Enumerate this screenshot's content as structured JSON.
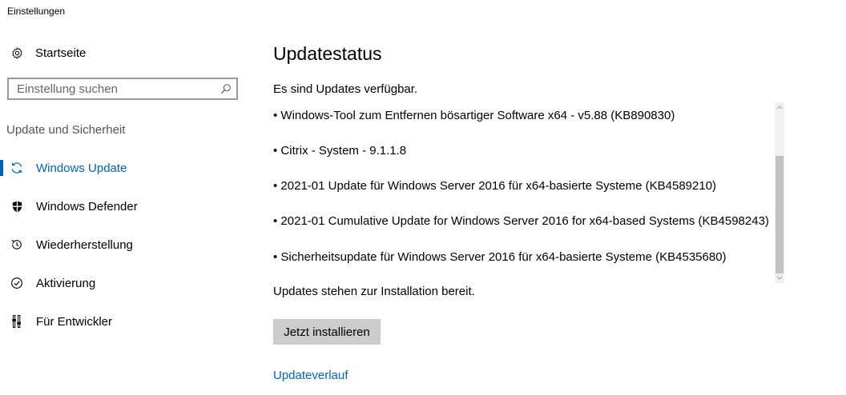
{
  "window": {
    "title": "Einstellungen"
  },
  "sidebar": {
    "home_label": "Startseite",
    "search": {
      "placeholder": "Einstellung suchen",
      "value": ""
    },
    "section_title": "Update und Sicherheit",
    "items": [
      {
        "label": "Windows Update",
        "icon": "refresh-icon",
        "active": true
      },
      {
        "label": "Windows Defender",
        "icon": "shield-icon",
        "active": false
      },
      {
        "label": "Wiederherstellung",
        "icon": "history-icon",
        "active": false
      },
      {
        "label": "Aktivierung",
        "icon": "check-circle-icon",
        "active": false
      },
      {
        "label": "Für Entwickler",
        "icon": "developer-tools-icon",
        "active": false
      }
    ]
  },
  "main": {
    "title": "Updatestatus",
    "status": "Es sind Updates verfügbar.",
    "updates": [
      "• Windows-Tool zum Entfernen bösartiger Software x64 - v5.88 (KB890830)",
      "• Citrix - System - 9.1.1.8",
      "• 2021-01 Update für Windows Server 2016 für x64-basierte Systeme (KB4589210)",
      "• 2021-01 Cumulative Update for Windows Server 2016 for x64-based Systems (KB4598243)",
      "• Sicherheitsupdate für Windows Server 2016 für x64-basierte Systeme (KB4535680)"
    ],
    "ready_text": "Updates stehen zur Installation bereit.",
    "install_button": "Jetzt installieren",
    "history_link": "Updateverlauf"
  },
  "colors": {
    "accent": "#0063b1",
    "button_bg": "#cccccc",
    "scroll_thumb": "#c2c2c2"
  }
}
